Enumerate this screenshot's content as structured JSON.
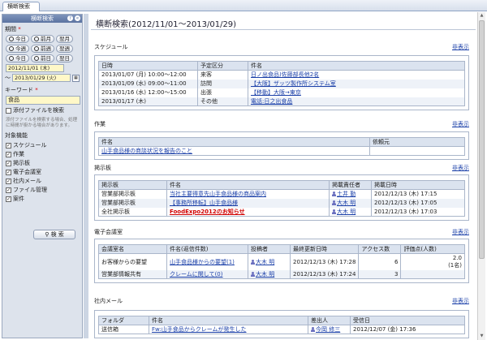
{
  "tab": {
    "label": "横断検索"
  },
  "sidebar": {
    "title": "横断検索",
    "period_label": "期間",
    "required_mark": "*",
    "btn_today": "今日",
    "btn_prev_month": "前月",
    "btn_next_month": "翌月",
    "btn_this_week": "今週",
    "btn_prev_week": "前週",
    "btn_next_week": "翌週",
    "btn_prev_day": "前日",
    "btn_next_day": "翌日",
    "date_from": "2012/11/01 (木)",
    "date_to_prefix": "～",
    "date_to": "2013/01/29 (火)",
    "keyword_label": "キーワード",
    "keyword_value": "食品",
    "attach_label": "添付ファイルを検索",
    "note": "添付ファイルを検索する場合、処理に時間が掛かる場合があります。",
    "targets_label": "対象機能",
    "targets": [
      "スケジュール",
      "作業",
      "掲示板",
      "電子会議室",
      "社内メール",
      "ファイル管理",
      "案件"
    ],
    "search_button": "検 索"
  },
  "main": {
    "title": "横断検索(2012/11/01～2013/01/29)",
    "hide": "非表示",
    "schedule": {
      "title": "スケジュール",
      "headers": [
        "日時",
        "予定区分",
        "件名"
      ],
      "rows": [
        [
          "2013/01/07 (月) 10:00～12:00",
          "来客",
          "日ノ出食品)佐藤部長他2名"
        ],
        [
          "2013/01/09 (水) 09:00～11:00",
          "訪問",
          "【大阪】ザッツ製作所システム室"
        ],
        [
          "2013/01/16 (水) 12:00～15:00",
          "出張",
          "【移動】大阪→東京"
        ],
        [
          "2013/01/17 (木)",
          "その他",
          "電話:日之出食品"
        ]
      ]
    },
    "work": {
      "title": "作業",
      "headers": [
        "件名",
        "依頼元"
      ],
      "rows": [
        [
          "山手食品様の商談状況を報告のこと",
          ""
        ]
      ]
    },
    "bbs": {
      "title": "掲示板",
      "headers": [
        "掲示板",
        "件名",
        "掲載責任者",
        "掲載日時"
      ],
      "rows": [
        [
          "営業部掲示板",
          "当社主要得意先山手食品様の商品案内",
          "土井 勤",
          "2012/12/13 (木) 17:15"
        ],
        [
          "営業部掲示板",
          "【事務所移転】山手食品様",
          "大木 明",
          "2012/12/13 (木) 17:05"
        ],
        [
          "全社掲示板",
          "FoodExpo2012のお知らせ",
          "大木 明",
          "2012/12/13 (木) 17:03"
        ]
      ]
    },
    "conf": {
      "title": "電子会議室",
      "headers": [
        "会議室名",
        "件名(返信件数)",
        "投稿者",
        "最終更新日時",
        "アクセス数",
        "評価点(人数)"
      ],
      "rows": [
        [
          "お客様からの要望",
          "山手食品様からの要望(1)",
          "大木 明",
          "2012/12/13 (木) 17:28",
          "6",
          "2.0",
          "(1名)"
        ],
        [
          "営業部情報共有",
          "クレームに関して(0)",
          "大木 明",
          "2012/12/13 (木) 17:24",
          "3",
          "",
          ""
        ]
      ]
    },
    "mail": {
      "title": "社内メール",
      "headers": [
        "フォルダ",
        "件名",
        "差出人",
        "受信日"
      ],
      "rows": [
        [
          "送信箱",
          "Fw:山手食品からクレームが発生した",
          "今岡 修三",
          "2012/12/07 (金) 17:36"
        ]
      ]
    }
  }
}
